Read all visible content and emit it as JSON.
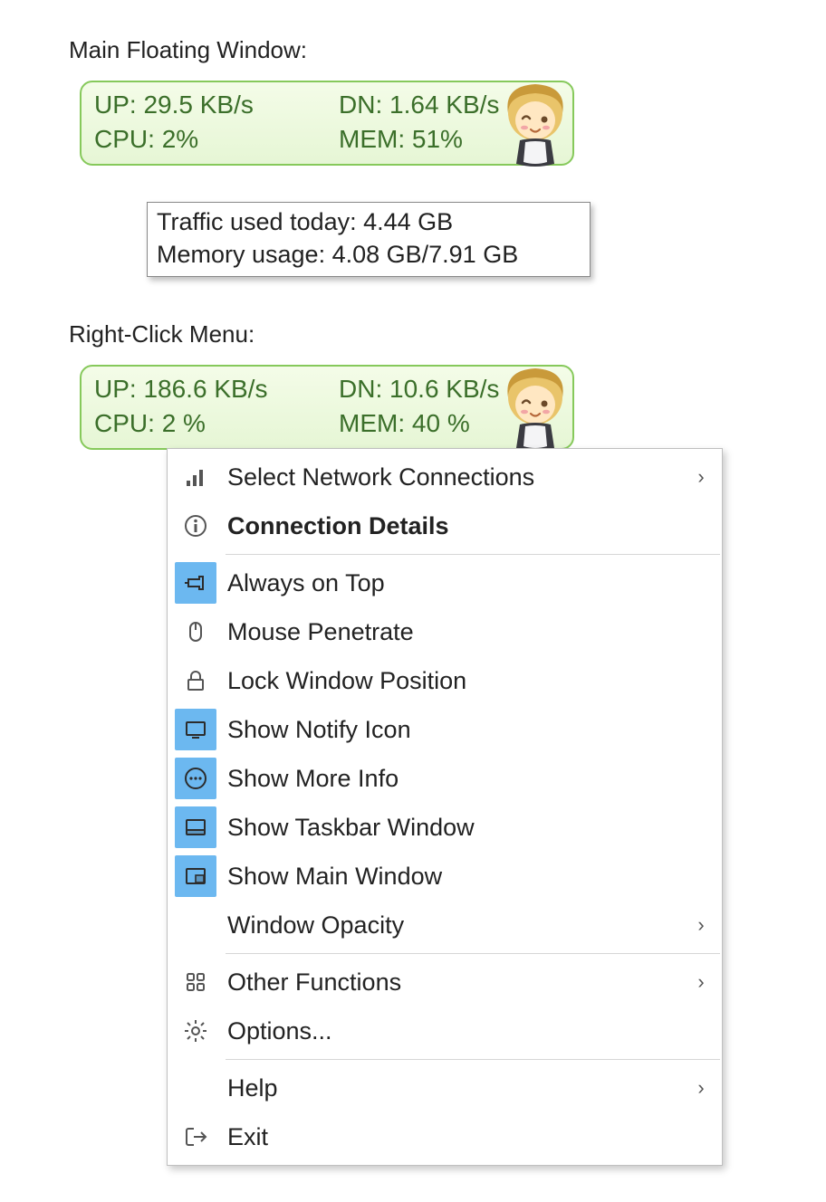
{
  "section1": {
    "title": "Main Floating Window:"
  },
  "widget1": {
    "up_label": "UP:",
    "up_value": "29.5 KB/s",
    "dn_label": "DN:",
    "dn_value": "1.64 KB/s",
    "cpu_label": "CPU:",
    "cpu_value": "2%",
    "mem_label": "MEM:",
    "mem_value": "51%"
  },
  "tooltip": {
    "line1": "Traffic used today: 4.44 GB",
    "line2": "Memory usage: 4.08 GB/7.91 GB"
  },
  "section2": {
    "title": "Right-Click Menu:"
  },
  "widget2": {
    "up_label": "UP:",
    "up_value": "186.6 KB/s",
    "dn_label": "DN:",
    "dn_value": "10.6 KB/s",
    "cpu_label": "CPU:",
    "cpu_value": "2 %",
    "mem_label": "MEM:",
    "mem_value": "40 %"
  },
  "menu": {
    "items": [
      {
        "label": "Select Network Connections",
        "icon": "signal-bars",
        "submenu": true,
        "active": false,
        "bold": false
      },
      {
        "label": "Connection Details",
        "icon": "info-circle",
        "submenu": false,
        "active": false,
        "bold": true
      },
      {
        "sep": true
      },
      {
        "label": "Always on Top",
        "icon": "pin",
        "submenu": false,
        "active": true,
        "bold": false
      },
      {
        "label": "Mouse Penetrate",
        "icon": "mouse",
        "submenu": false,
        "active": false,
        "bold": false
      },
      {
        "label": "Lock Window Position",
        "icon": "lock",
        "submenu": false,
        "active": false,
        "bold": false
      },
      {
        "label": "Show Notify Icon",
        "icon": "tray",
        "submenu": false,
        "active": true,
        "bold": false
      },
      {
        "label": "Show More Info",
        "icon": "more-circle",
        "submenu": false,
        "active": true,
        "bold": false
      },
      {
        "label": "Show Taskbar Window",
        "icon": "taskbar",
        "submenu": false,
        "active": true,
        "bold": false
      },
      {
        "label": "Show Main Window",
        "icon": "main-window",
        "submenu": false,
        "active": true,
        "bold": false
      },
      {
        "label": "Window Opacity",
        "icon": "",
        "submenu": true,
        "active": false,
        "bold": false
      },
      {
        "sep": true
      },
      {
        "label": "Other Functions",
        "icon": "grid-4",
        "submenu": true,
        "active": false,
        "bold": false
      },
      {
        "label": "Options...",
        "icon": "gear",
        "submenu": false,
        "active": false,
        "bold": false
      },
      {
        "sep": true
      },
      {
        "label": "Help",
        "icon": "",
        "submenu": true,
        "active": false,
        "bold": false
      },
      {
        "label": "Exit",
        "icon": "exit",
        "submenu": false,
        "active": false,
        "bold": false
      }
    ]
  }
}
